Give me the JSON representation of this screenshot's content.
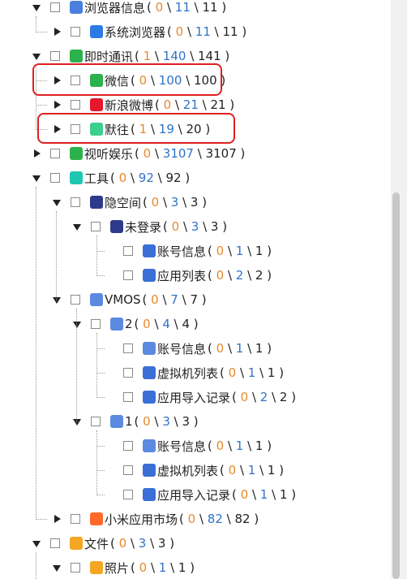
{
  "tree": [
    {
      "id": "browser-info",
      "label": "浏览器信息",
      "c1": "0",
      "c2": "11",
      "c3": "11",
      "icon": "browser-icon",
      "icon_color": "#4a7fe0",
      "state": "expanded"
    },
    {
      "id": "system-browser",
      "label": "系统浏览器",
      "c1": "0",
      "c2": "11",
      "c3": "11",
      "icon": "safari-icon",
      "icon_color": "#2c7be5",
      "state": "collapsed"
    },
    {
      "id": "instant-messaging",
      "label": "即时通讯",
      "c1": "1",
      "c2": "140",
      "c3": "141",
      "icon": "chat-icon",
      "icon_color": "#2bb24c",
      "state": "expanded"
    },
    {
      "id": "wechat",
      "label": "微信",
      "c1": "0",
      "c2": "100",
      "c3": "100",
      "icon": "wechat-icon",
      "icon_color": "#2bb24c",
      "state": "collapsed"
    },
    {
      "id": "sina-weibo",
      "label": "新浪微博",
      "c1": "0",
      "c2": "21",
      "c3": "21",
      "icon": "weibo-icon",
      "icon_color": "#e6162d",
      "state": "collapsed"
    },
    {
      "id": "mowang",
      "label": "默往",
      "c1": "1",
      "c2": "19",
      "c3": "20",
      "icon": "mowang-icon",
      "icon_color": "#3ccf8e",
      "state": "collapsed"
    },
    {
      "id": "audio-video",
      "label": "视听娱乐",
      "c1": "0",
      "c2": "3107",
      "c3": "3107",
      "icon": "media-icon",
      "icon_color": "#2bb24c",
      "state": "collapsed"
    },
    {
      "id": "tools",
      "label": "工具",
      "c1": "0",
      "c2": "92",
      "c3": "92",
      "icon": "tools-icon",
      "icon_color": "#1fc7b0",
      "state": "expanded"
    },
    {
      "id": "hidden-space",
      "label": "隐空间",
      "c1": "0",
      "c2": "3",
      "c3": "3",
      "icon": "hidden-space-icon",
      "icon_color": "#2d3a8c",
      "state": "expanded"
    },
    {
      "id": "not-logged-in",
      "label": "未登录",
      "c1": "0",
      "c2": "3",
      "c3": "3",
      "icon": "user-icon",
      "icon_color": "#2d3a8c",
      "state": "expanded"
    },
    {
      "id": "hs-account-info",
      "label": "账号信息",
      "c1": "0",
      "c2": "1",
      "c3": "1",
      "icon": "account-icon",
      "icon_color": "#3a6fd8",
      "state": "none"
    },
    {
      "id": "hs-app-list",
      "label": "应用列表",
      "c1": "0",
      "c2": "2",
      "c3": "2",
      "icon": "list-icon",
      "icon_color": "#3a6fd8",
      "state": "none"
    },
    {
      "id": "vmos",
      "label": "VMOS",
      "c1": "0",
      "c2": "7",
      "c3": "7",
      "icon": "vmos-icon",
      "icon_color": "#5b8be0",
      "state": "expanded"
    },
    {
      "id": "vmos-2",
      "label": "2",
      "c1": "0",
      "c2": "4",
      "c3": "4",
      "icon": "vmos-icon",
      "icon_color": "#5b8be0",
      "state": "expanded"
    },
    {
      "id": "v2-account-info",
      "label": "账号信息",
      "c1": "0",
      "c2": "1",
      "c3": "1",
      "icon": "vmos-icon",
      "icon_color": "#5b8be0",
      "state": "none"
    },
    {
      "id": "v2-vm-list",
      "label": "虚拟机列表",
      "c1": "0",
      "c2": "1",
      "c3": "1",
      "icon": "vm-list-icon",
      "icon_color": "#3a6fd8",
      "state": "none"
    },
    {
      "id": "v2-app-import",
      "label": "应用导入记录",
      "c1": "0",
      "c2": "2",
      "c3": "2",
      "icon": "import-record-icon",
      "icon_color": "#3a6fd8",
      "state": "none"
    },
    {
      "id": "vmos-1",
      "label": "1",
      "c1": "0",
      "c2": "3",
      "c3": "3",
      "icon": "vmos-icon",
      "icon_color": "#5b8be0",
      "state": "expanded"
    },
    {
      "id": "v1-account-info",
      "label": "账号信息",
      "c1": "0",
      "c2": "1",
      "c3": "1",
      "icon": "vmos-icon",
      "icon_color": "#5b8be0",
      "state": "none"
    },
    {
      "id": "v1-vm-list",
      "label": "虚拟机列表",
      "c1": "0",
      "c2": "1",
      "c3": "1",
      "icon": "vm-list-icon",
      "icon_color": "#3a6fd8",
      "state": "none"
    },
    {
      "id": "v1-app-import",
      "label": "应用导入记录",
      "c1": "0",
      "c2": "1",
      "c3": "1",
      "icon": "import-record-icon",
      "icon_color": "#3a6fd8",
      "state": "none"
    },
    {
      "id": "xiaomi-store",
      "label": "小米应用市场",
      "c1": "0",
      "c2": "82",
      "c3": "82",
      "icon": "xiaomi-icon",
      "icon_color": "#ff6a2a",
      "state": "collapsed"
    },
    {
      "id": "files",
      "label": "文件",
      "c1": "0",
      "c2": "3",
      "c3": "3",
      "icon": "file-icon",
      "icon_color": "#f5a623",
      "state": "expanded"
    },
    {
      "id": "photos",
      "label": "照片",
      "c1": "0",
      "c2": "1",
      "c3": "1",
      "icon": "photo-icon",
      "icon_color": "#f5a623",
      "state": "expanded"
    }
  ],
  "colors": {
    "count_first": "#e8892b",
    "count_second": "#2f73c8",
    "highlight": "#e02020"
  }
}
